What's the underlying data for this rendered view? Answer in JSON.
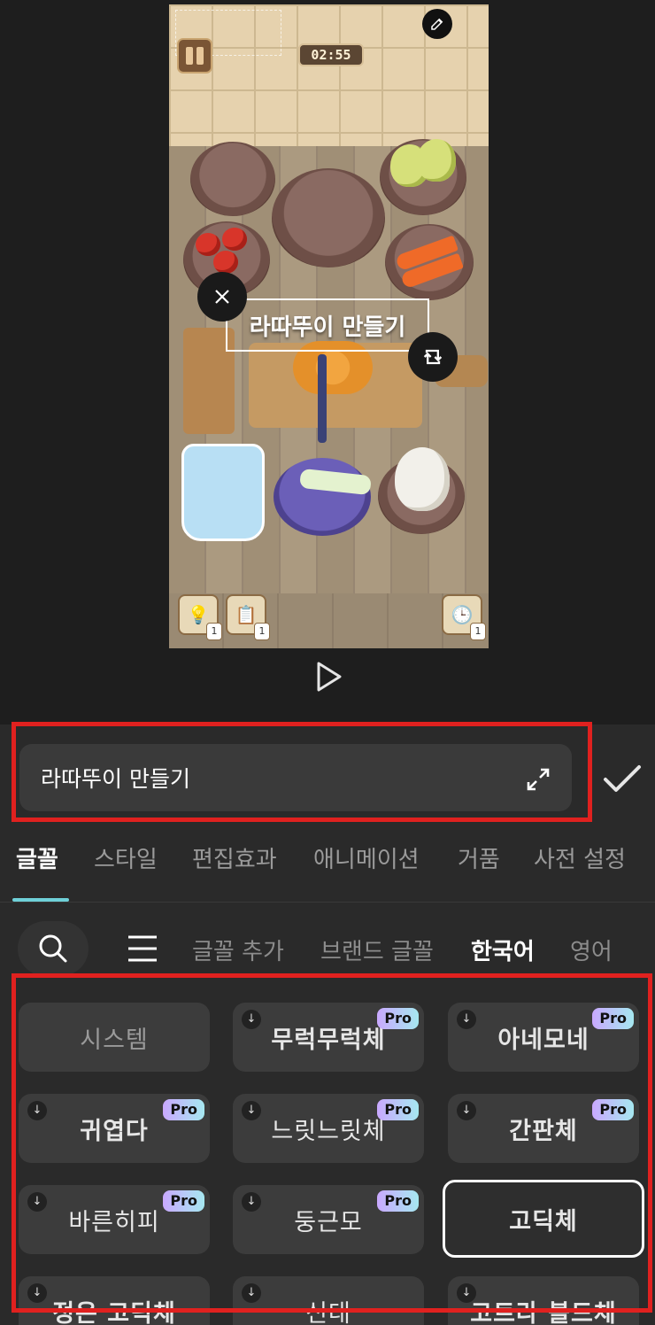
{
  "preview": {
    "timer": "02:55",
    "overlay_text": "라따뚜이 만들기",
    "item_counts": [
      "1",
      "1",
      "1"
    ]
  },
  "editor": {
    "text_value": "라따뚜이 만들기"
  },
  "tabs": [
    {
      "label": "글꼴",
      "active": true
    },
    {
      "label": "스타일"
    },
    {
      "label": "편집효과"
    },
    {
      "label": "애니메이션"
    },
    {
      "label": "거품"
    },
    {
      "label": "사전 설정"
    }
  ],
  "filters": [
    {
      "label": "글꼴 추가"
    },
    {
      "label": "브랜드 글꼴"
    },
    {
      "label": "한국어",
      "active": true
    },
    {
      "label": "영어"
    }
  ],
  "fonts": [
    {
      "name": "시스템",
      "download": false,
      "pro": false
    },
    {
      "name": "무럭무럭체",
      "download": true,
      "pro": true
    },
    {
      "name": "아네모네",
      "download": true,
      "pro": true
    },
    {
      "name": "귀엽다",
      "download": true,
      "pro": true
    },
    {
      "name": "느릿느릿체",
      "download": true,
      "pro": true
    },
    {
      "name": "간판체",
      "download": true,
      "pro": true
    },
    {
      "name": "바른히피",
      "download": true,
      "pro": true
    },
    {
      "name": "둥근모",
      "download": true,
      "pro": true
    },
    {
      "name": "고딕체",
      "download": false,
      "pro": false,
      "selected": true
    },
    {
      "name": "정은 고딕체",
      "download": true,
      "pro": false
    },
    {
      "name": "신대",
      "download": true,
      "pro": false
    },
    {
      "name": "코트라 볼드체",
      "download": true,
      "pro": false
    }
  ],
  "pro_label": "Pro",
  "download_glyph": "↓",
  "colors": {
    "accent_underline": "#6fd0d8",
    "highlight_box": "#e0211f",
    "panel_bg": "#2a2a2a",
    "card_bg": "#3c3c3c"
  }
}
